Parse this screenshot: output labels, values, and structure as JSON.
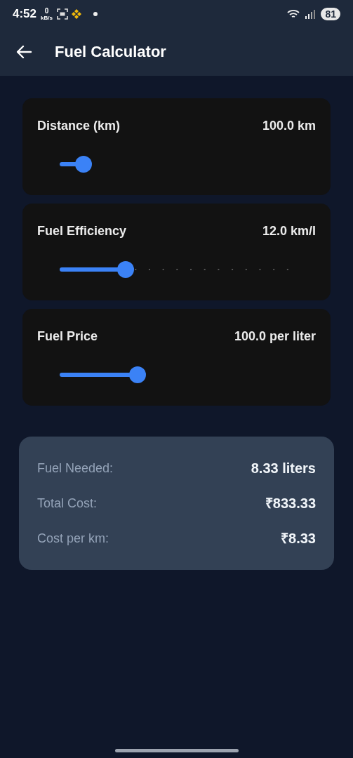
{
  "status_bar": {
    "time": "4:52",
    "net_speed_value": "0",
    "net_speed_unit": "kB/s",
    "battery": "81"
  },
  "app_bar": {
    "title": "Fuel Calculator"
  },
  "inputs": [
    {
      "label": "Distance (km)",
      "reading": "100.0 km",
      "level": 0.1,
      "kind": "plain"
    },
    {
      "label": "Fuel Efficiency",
      "reading": "12.0 km/l",
      "level": 0.28,
      "kind": "stepped"
    },
    {
      "label": "Fuel Price",
      "reading": "100.0 per liter",
      "level": 0.33,
      "kind": "plain"
    }
  ],
  "results": [
    {
      "label": "Fuel Needed:",
      "value": "8.33 liters"
    },
    {
      "label": "Total Cost:",
      "value": "₹833.33"
    },
    {
      "label": "Cost per km:",
      "value": "₹8.33"
    }
  ]
}
